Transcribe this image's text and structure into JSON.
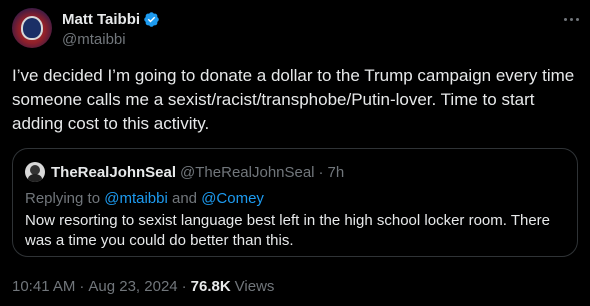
{
  "author": {
    "display_name": "Matt Taibbi",
    "handle": "@mtaibbi"
  },
  "tweet": {
    "text": "I’ve decided I’m going to donate a dollar to the Trump campaign every time someone calls me a sexist/racist/transphobe/Putin-lover. Time to start adding cost to this activity."
  },
  "quote": {
    "display_name": "TheRealJohnSeal",
    "handle": "@TheRealJohnSeal",
    "separator": "·",
    "time": "7h",
    "replying_prefix": "Replying to ",
    "replying_user1": "@mtaibbi",
    "replying_and": " and ",
    "replying_user2": "@Comey",
    "text": "Now resorting to sexist language best left in the high school locker room. There was a time you could do better than this."
  },
  "meta": {
    "time": "10:41 AM",
    "separator": "·",
    "date": "Aug 23, 2024",
    "views_count": "76.8K",
    "views_label": "Views"
  },
  "colors": {
    "background": "#000000",
    "text": "#e7e9ea",
    "muted": "#71767b",
    "link": "#1d9bf0",
    "border": "#2f3336",
    "verified": "#1d9bf0"
  },
  "icons": {
    "verified": "verified-badge-icon",
    "more": "more-horizontal-icon"
  }
}
